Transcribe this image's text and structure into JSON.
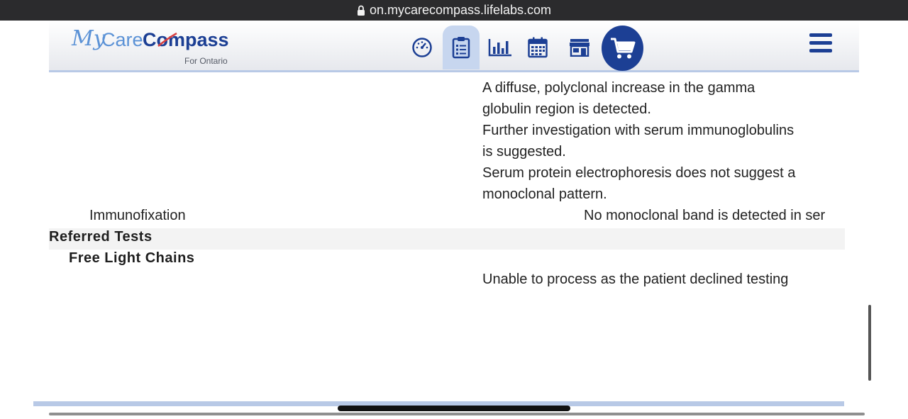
{
  "browser": {
    "url": "on.mycarecompass.lifelabs.com"
  },
  "header": {
    "logo": {
      "my": "My",
      "care": "Care",
      "compass": "Compass",
      "subtitle": "For Ontario"
    },
    "nav": [
      {
        "icon": "dashboard-gauge-icon",
        "active": false
      },
      {
        "icon": "clipboard-results-icon",
        "active": true
      },
      {
        "icon": "bar-chart-icon",
        "active": false
      },
      {
        "icon": "calendar-icon",
        "active": false
      },
      {
        "icon": "store-icon",
        "active": false
      },
      {
        "icon": "cart-icon",
        "active": false
      }
    ],
    "menu_icon": "hamburger-menu-icon"
  },
  "results": {
    "spe_comment_lines": [
      "A diffuse, polyclonal increase in the gamma",
      "globulin region is detected.",
      "Further investigation with serum immunoglobulins",
      "is suggested.",
      "Serum protein electrophoresis does not suggest a",
      "monoclonal pattern."
    ],
    "immunofixation": {
      "label": "Immunofixation",
      "value": "No monoclonal band is detected in ser"
    },
    "referred_section": "Referred Tests",
    "flc": {
      "label": "Free Light Chains",
      "value": "Unable to process as the patient declined testing"
    }
  },
  "colors": {
    "brand_dark": "#1c3f94",
    "brand_light": "#5b92d6",
    "active_tab": "#c7d6ef"
  }
}
